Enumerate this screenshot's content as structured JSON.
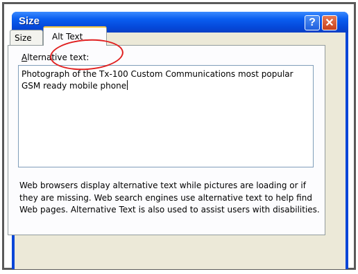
{
  "dialog": {
    "title": "Size",
    "help_button_label": "?",
    "close_button_label": "✕"
  },
  "tabs": [
    {
      "label": "Size",
      "active": false
    },
    {
      "label": "Alt Text",
      "active": true
    }
  ],
  "alt_text": {
    "label_accel": "A",
    "label_rest": "lternative text:",
    "value": "Photograph of the Tx-100 Custom Communications most popular GSM ready mobile phone"
  },
  "help_text": "Web browsers display alternative text while pictures are loading or if they are missing.  Web search engines use alternative text to help find Web pages.  Alternative Text is also used to assist users with disabilities.",
  "colors": {
    "annotation": "#e02020",
    "titlebar": "#0a5ef0",
    "dialog_face": "#ece9d8"
  }
}
